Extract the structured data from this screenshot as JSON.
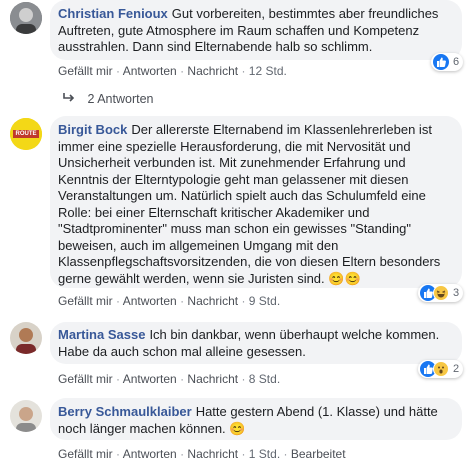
{
  "comments": [
    {
      "author": "Christian Fenioux",
      "text": "Gut vorbereiten, bestimmtes aber freundliches Auftreten, gute Atmosphere im Raum schaffen und Kompetenz ausstrahlen. Dann sind Elternabende halb so schlimm.",
      "like": "Gefällt mir",
      "reply": "Antworten",
      "message": "Nachricht",
      "time": "12 Std.",
      "reaction_count": "6",
      "reactions": [
        "like-icon"
      ]
    },
    {
      "author": "Birgit Bock",
      "text": "Der allererste Elternabend im Klassenlehrerleben ist immer eine spezielle Herausforderung, die mit Nervosität und Unsicherheit verbunden ist. Mit zunehmender Erfahrung und Kenntnis der Elterntypologie geht man gelassener mit diesen Veranstaltungen um. Natürlich spielt auch das Schulumfeld eine Rolle: bei einer Elternschaft kritischer Akademiker und \"Stadtprominenter\" muss man schon ein gewisses \"Standing\" beweisen, auch im allgemeinen Umgang mit den Klassenpflegschaftsvorsitzenden, die von diesen Eltern besonders gerne gewählt werden, wenn sie Juristen sind. 😊😊",
      "like": "Gefällt mir",
      "reply": "Antworten",
      "message": "Nachricht",
      "time": "9 Std.",
      "reaction_count": "3",
      "reactions": [
        "like-icon",
        "haha-icon"
      ],
      "avatar_text": "ROUTE"
    },
    {
      "author": "Martina Sasse",
      "text": "Ich bin dankbar, wenn überhaupt welche kommen. Habe da auch schon mal alleine gesessen.",
      "like": "Gefällt mir",
      "reply": "Antworten",
      "message": "Nachricht",
      "time": "8 Std.",
      "reaction_count": "2",
      "reactions": [
        "like-icon",
        "wow-icon"
      ]
    },
    {
      "author": "Berry Schmaulklaiber",
      "text": "Hatte gestern Abend (1. Klasse) und hätte noch länger machen können. 😊",
      "like": "Gefällt mir",
      "reply": "Antworten",
      "message": "Nachricht",
      "time": "1 Std.",
      "edited": "Bearbeitet"
    }
  ],
  "replies_link": "2 Antworten",
  "colors": {
    "author": "#385898",
    "like": "#1877f2",
    "bubble": "#f2f3f5"
  }
}
